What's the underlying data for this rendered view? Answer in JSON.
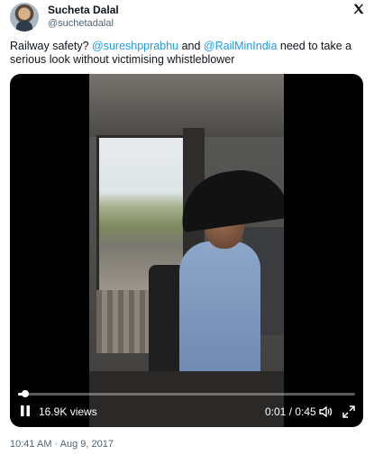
{
  "tweet": {
    "author_name": "Sucheta Dalal",
    "author_handle": "@suchetadalal",
    "text_parts": [
      {
        "text": "Railway safety? ",
        "type": "plain"
      },
      {
        "text": "@sureshpprabhu",
        "type": "mention"
      },
      {
        "text": " and ",
        "type": "plain"
      },
      {
        "text": "@RailMinIndia",
        "type": "mention"
      },
      {
        "text": " need to take a serious look without victimising whistleblower",
        "type": "plain"
      }
    ],
    "timestamp": "10:41 AM · Aug 9, 2017"
  },
  "video": {
    "views": "16.9K views",
    "time": "0:01 / 0:45",
    "progress_fraction": 0.022
  },
  "icons": {
    "platform": "x-logo-icon",
    "play_state": "pause-icon",
    "volume": "volume-icon",
    "fullscreen": "fullscreen-icon"
  },
  "colors": {
    "mention": "#1d9bf0",
    "secondary_text": "#536471",
    "primary_text": "#0f1419"
  }
}
